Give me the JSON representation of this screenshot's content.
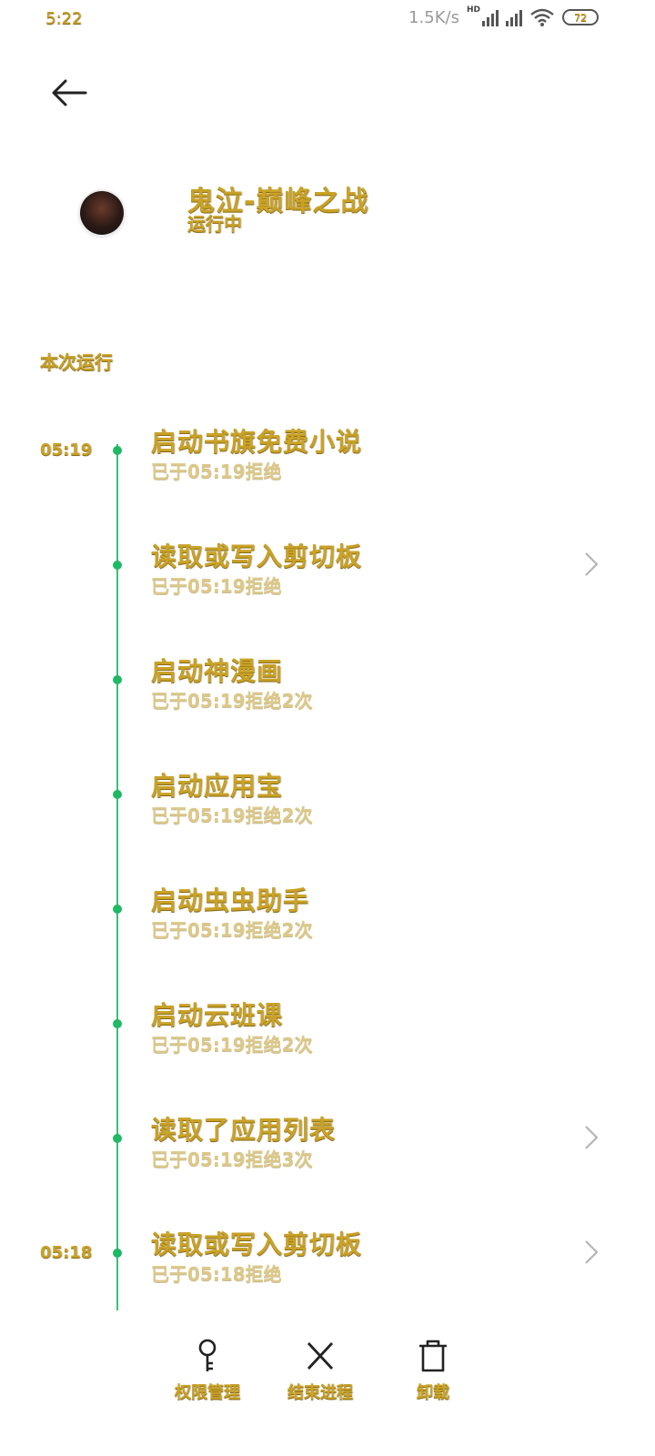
{
  "status_bar": {
    "time": "5:22",
    "net_speed": "1.5K/s",
    "hd_badge": "HD",
    "battery": "72"
  },
  "header": {
    "app_name": "鬼泣-巅峰之战",
    "app_status": "运行中"
  },
  "section_label": "本次运行",
  "entries": [
    {
      "time": "05:19",
      "title": "启动书旗免费小说",
      "sub": "已于05:19拒绝",
      "chevron": false
    },
    {
      "time": "",
      "title": "读取或写入剪切板",
      "sub": "已于05:19拒绝",
      "chevron": true
    },
    {
      "time": "",
      "title": "启动神漫画",
      "sub": "已于05:19拒绝2次",
      "chevron": false
    },
    {
      "time": "",
      "title": "启动应用宝",
      "sub": "已于05:19拒绝2次",
      "chevron": false
    },
    {
      "time": "",
      "title": "启动虫虫助手",
      "sub": "已于05:19拒绝2次",
      "chevron": false
    },
    {
      "time": "",
      "title": "启动云班课",
      "sub": "已于05:19拒绝2次",
      "chevron": false
    },
    {
      "time": "",
      "title": "读取了应用列表",
      "sub": "已于05:19拒绝3次",
      "chevron": true
    },
    {
      "time": "05:18",
      "title": "读取或写入剪切板",
      "sub": "已于05:18拒绝",
      "chevron": true
    }
  ],
  "bottom_actions": {
    "permissions": "权限管理",
    "end_process": "结束进程",
    "uninstall": "卸载"
  },
  "colors": {
    "accent_green": "#1fb864",
    "text_gold": "#c9a227"
  },
  "icons": {
    "back": "arrow-left-icon",
    "chevron": "chevron-right-icon",
    "permissions": "key-icon",
    "end_process": "close-icon",
    "uninstall": "trash-icon"
  }
}
